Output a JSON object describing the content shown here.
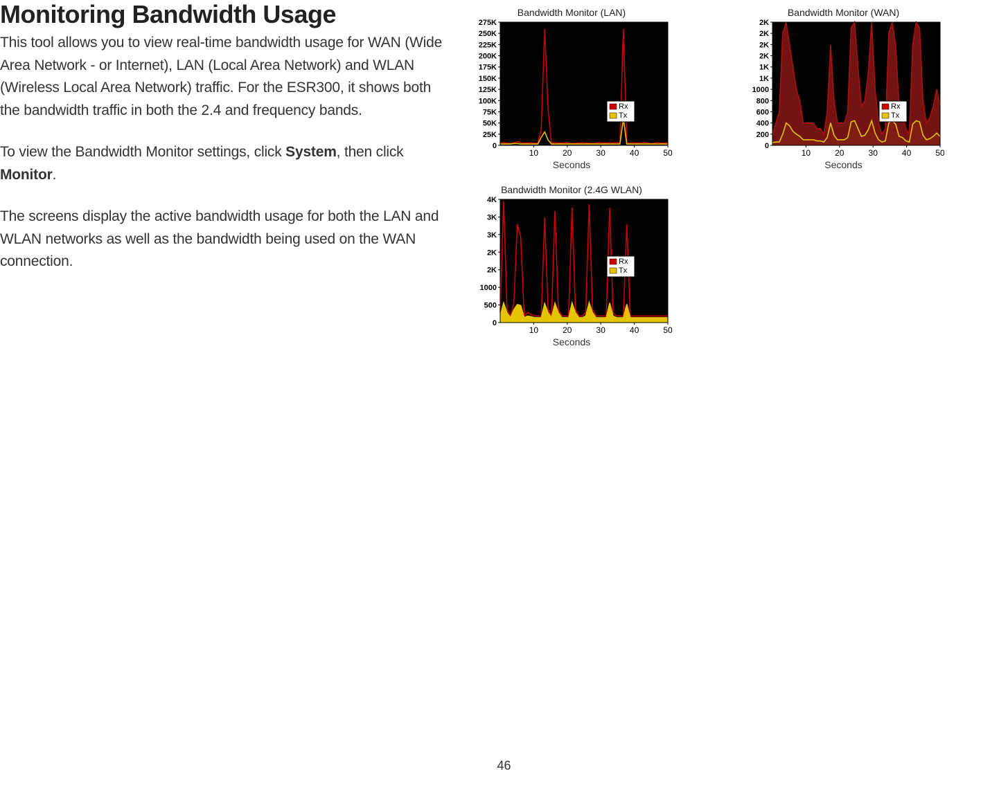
{
  "heading": "Monitoring Bandwidth Usage",
  "para1": "This tool allows you to view real-time bandwidth usage for WAN (Wide Area Network - or Internet), LAN (Local Area Network) and WLAN (Wireless Local Area Network) traffic. For the ESR300, it shows both the bandwidth traffic in both the 2.4 and  frequency bands.",
  "para2a": "To view the Bandwidth Monitor settings, click ",
  "para2b": "System",
  "para2c": ", then click ",
  "para2d": "Monitor",
  "para2e": ".",
  "para3": "The screens display the active bandwidth usage for both the LAN and WLAN networks as well as the bandwidth being used on the WAN connection.",
  "page_number": "46",
  "legend": {
    "rx": "Rx",
    "tx": "Tx"
  },
  "chart_data": [
    {
      "id": "lan",
      "title": "Bandwidth Monitor (LAN)",
      "type": "line",
      "xlabel": "Seconds",
      "xticks": [
        "10",
        "20",
        "30",
        "40",
        "50"
      ],
      "yticks": [
        "275K",
        "250K",
        "225K",
        "200K",
        "175K",
        "150K",
        "125K",
        "100K",
        "75K",
        "50K",
        "25K",
        "0"
      ],
      "ylim": [
        0,
        275
      ],
      "series": [
        {
          "name": "Rx",
          "color": "#c00",
          "values": [
            5,
            6,
            5,
            4,
            6,
            8,
            6,
            5,
            5,
            6,
            5,
            4,
            35,
            260,
            80,
            5,
            6,
            5,
            5,
            6,
            5,
            4,
            5,
            5,
            6,
            5,
            5,
            4,
            5,
            6,
            5,
            5,
            6,
            5,
            6,
            5,
            260,
            6,
            5,
            6,
            5,
            5,
            6,
            5,
            4,
            5,
            6,
            5,
            5,
            6
          ]
        },
        {
          "name": "Tx",
          "color": "#e6c200",
          "values": [
            3,
            3,
            3,
            3,
            4,
            4,
            3,
            3,
            3,
            3,
            3,
            3,
            18,
            30,
            12,
            3,
            3,
            3,
            3,
            3,
            3,
            3,
            3,
            3,
            3,
            3,
            3,
            3,
            3,
            3,
            3,
            3,
            3,
            3,
            3,
            3,
            60,
            3,
            3,
            3,
            3,
            3,
            3,
            3,
            3,
            3,
            3,
            3,
            3,
            3
          ]
        }
      ],
      "legend_pos": {
        "x": 196,
        "y": 118
      }
    },
    {
      "id": "wan",
      "title": "Bandwidth Monitor (WAN)",
      "type": "area",
      "xlabel": "Seconds",
      "xticks": [
        "10",
        "20",
        "30",
        "40",
        "50"
      ],
      "yticks": [
        "2K",
        "2K",
        "2K",
        "2K",
        "1K",
        "1K",
        "1000",
        "800",
        "600",
        "400",
        "200",
        "0"
      ],
      "ylim": [
        0,
        2200
      ],
      "series": [
        {
          "name": "Rx",
          "color": "#a11",
          "fill": "#7a1414",
          "values": [
            200,
            400,
            600,
            2000,
            2200,
            1800,
            1400,
            1000,
            800,
            400,
            400,
            400,
            400,
            300,
            300,
            200,
            600,
            1800,
            800,
            400,
            400,
            400,
            600,
            2100,
            2200,
            1400,
            700,
            800,
            1300,
            2200,
            1000,
            400,
            200,
            300,
            2000,
            2200,
            1800,
            700,
            600,
            300,
            200,
            1800,
            2200,
            2100,
            800,
            400,
            500,
            700,
            1000,
            700
          ]
        },
        {
          "name": "Tx",
          "color": "#e6c200",
          "fill": "#e6c200",
          "values": [
            50,
            60,
            60,
            200,
            400,
            350,
            250,
            200,
            160,
            100,
            100,
            100,
            100,
            80,
            80,
            60,
            140,
            400,
            180,
            100,
            100,
            100,
            140,
            420,
            440,
            300,
            160,
            180,
            280,
            440,
            220,
            100,
            60,
            80,
            400,
            440,
            380,
            160,
            140,
            80,
            60,
            380,
            440,
            420,
            180,
            100,
            120,
            160,
            220,
            160
          ]
        }
      ],
      "legend_pos": {
        "x": 196,
        "y": 118
      }
    },
    {
      "id": "wlan",
      "title": "Bandwidth Monitor (2.4G WLAN)",
      "type": "line-area",
      "xlabel": "Seconds",
      "xticks": [
        "10",
        "20",
        "30",
        "40",
        "50"
      ],
      "yticks": [
        "4K",
        "3K",
        "3K",
        "2K",
        "2K",
        "1000",
        "500",
        "0"
      ],
      "ylim": [
        0,
        3750
      ],
      "series": [
        {
          "name": "Rx",
          "color": "#c00",
          "values": [
            300,
            3700,
            400,
            200,
            600,
            3000,
            2600,
            200,
            300,
            250,
            200,
            200,
            200,
            3200,
            400,
            200,
            3400,
            400,
            200,
            200,
            200,
            3500,
            400,
            200,
            200,
            300,
            3600,
            400,
            200,
            200,
            200,
            200,
            3500,
            300,
            200,
            200,
            200,
            3000,
            200,
            200,
            200,
            200,
            200,
            200,
            200,
            200,
            200,
            200,
            200,
            200
          ]
        },
        {
          "name": "Tx",
          "color": "#e6c200",
          "fill": "#f0d000",
          "values": [
            200,
            600,
            300,
            150,
            400,
            550,
            520,
            150,
            200,
            180,
            150,
            150,
            150,
            580,
            300,
            150,
            590,
            300,
            150,
            150,
            150,
            600,
            300,
            150,
            150,
            200,
            610,
            300,
            150,
            150,
            150,
            150,
            600,
            200,
            150,
            150,
            150,
            560,
            150,
            150,
            150,
            150,
            150,
            150,
            150,
            150,
            150,
            150,
            150,
            150
          ]
        }
      ],
      "legend_pos": {
        "x": 196,
        "y": 86
      }
    }
  ]
}
